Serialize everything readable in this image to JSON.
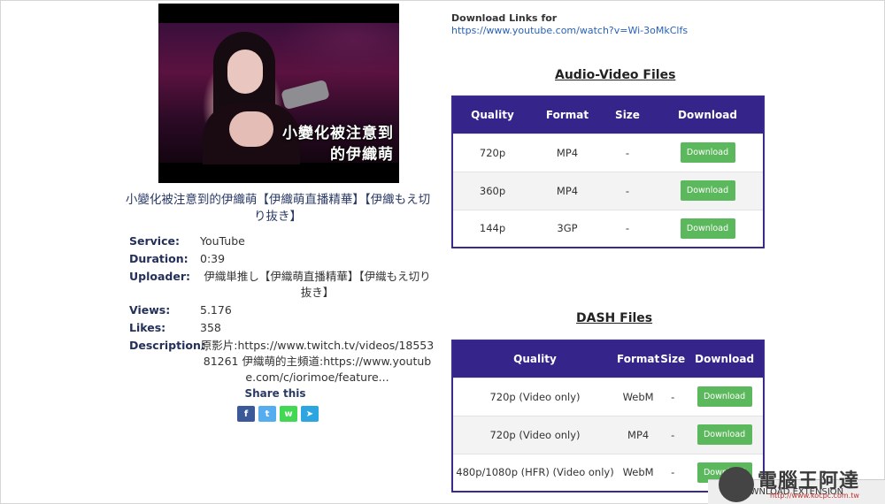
{
  "video": {
    "caption_line1": "小變化被注意到",
    "caption_line2": "的伊織萌",
    "title": "小變化被注意到的伊織萌【伊織萌直播精華】【伊織もえ切り抜き】"
  },
  "info": [
    {
      "key": "Service:",
      "value": "YouTube"
    },
    {
      "key": "Duration:",
      "value": "0:39"
    },
    {
      "key": "Uploader:",
      "value": "伊織単推し【伊織萌直播精華】【伊織もえ切り抜き】"
    },
    {
      "key": "Views:",
      "value": "5.176"
    },
    {
      "key": "Likes:",
      "value": "358"
    },
    {
      "key": "Description:",
      "value": "原影片:https://www.twitch.tv/videos/1855381261 伊織萌的主頻道:https://www.youtube.com/c/iorimoe/feature..."
    }
  ],
  "share": {
    "label": "Share this",
    "buttons": [
      {
        "glyph": "f",
        "color": "#3b5998"
      },
      {
        "glyph": "t",
        "color": "#55acee"
      },
      {
        "glyph": "w",
        "color": "#43d854"
      },
      {
        "glyph": "➤",
        "color": "#2ca5e0"
      }
    ]
  },
  "download_links": {
    "label": "Download Links for",
    "url": "https://www.youtube.com/watch?v=Wi-3oMkClfs"
  },
  "audio_video": {
    "title": "Audio-Video Files",
    "headers": [
      "Quality",
      "Format",
      "Size",
      "Download"
    ],
    "rows": [
      {
        "quality": "720p",
        "format": "MP4",
        "size": "-",
        "button": "Download"
      },
      {
        "quality": "360p",
        "format": "MP4",
        "size": "-",
        "button": "Download"
      },
      {
        "quality": "144p",
        "format": "3GP",
        "size": "-",
        "button": "Download"
      }
    ]
  },
  "dash": {
    "title": "DASH Files",
    "headers": [
      "Quality",
      "Format",
      "Size",
      "Download"
    ],
    "rows": [
      {
        "quality": "720p (Video only)",
        "format": "WebM",
        "size": "-",
        "button": "Download"
      },
      {
        "quality": "720p (Video only)",
        "format": "MP4",
        "size": "-",
        "button": "Download"
      },
      {
        "quality": "480p/1080p (HFR) (Video only)",
        "format": "WebM",
        "size": "-",
        "button": "Download"
      }
    ]
  },
  "extension_bar": {
    "label": "DOWNLOAD EXTENSION"
  },
  "watermark": {
    "text": "電腦王阿達",
    "url": "http://www.kocpc.com.tw"
  }
}
